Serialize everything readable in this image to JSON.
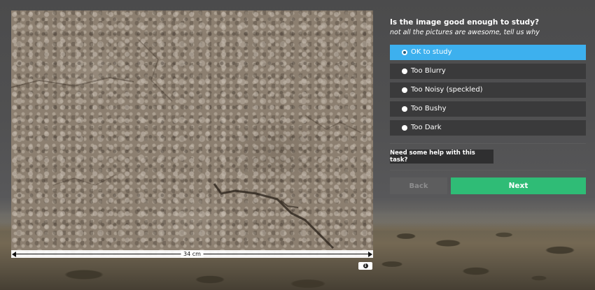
{
  "task": {
    "question": "Is the image good enough to study?",
    "subtitle": "not all the pictures are awesome, tell us why"
  },
  "options": [
    {
      "label": "OK to study",
      "selected": true
    },
    {
      "label": "Too Blurry",
      "selected": false
    },
    {
      "label": "Too Noisy (speckled)",
      "selected": false
    },
    {
      "label": "Too Bushy",
      "selected": false
    },
    {
      "label": "Too Dark",
      "selected": false
    }
  ],
  "buttons": {
    "help": "Need some help with this task?",
    "back": "Back",
    "next": "Next"
  },
  "image": {
    "scale_label": "34 cm",
    "info_icon": "info-icon"
  },
  "colors": {
    "selected": "#3db0ee",
    "next": "#2fbc76",
    "option_bg": "#3a3a3b"
  }
}
